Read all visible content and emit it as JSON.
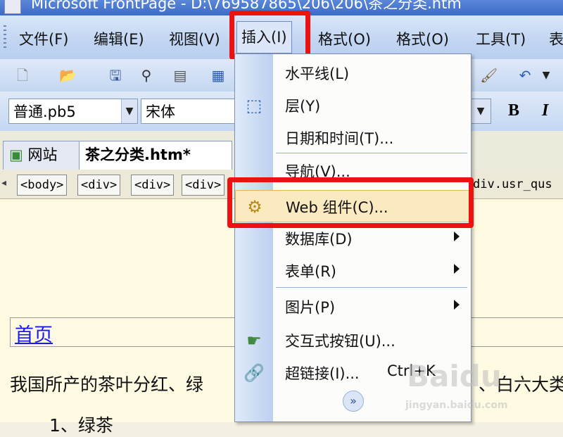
{
  "window": {
    "title": "Microsoft FrontPage - D:\\769587865\\206\\206\\茶之分类.htm"
  },
  "menubar": {
    "items": [
      "文件(F)",
      "编辑(E)",
      "视图(V)",
      "插入(I)",
      "格式(O)",
      "格式(O)",
      "工具(T)",
      "表"
    ],
    "active": "插入(I)"
  },
  "toolbar": {
    "style_combo": "普通.pb5",
    "font_combo": "宋体",
    "bold": "B",
    "italic": "I"
  },
  "tabs": [
    "网站",
    "茶之分类.htm*"
  ],
  "tagbar": [
    "<body>",
    "<div>",
    "<div>",
    "<div>",
    "div.usr_qus"
  ],
  "document": {
    "home_link": "首页",
    "paragraph": "我国所产的茶叶分红、绿",
    "paragraph_tail": "、白六大类",
    "list_item": "1、绿茶"
  },
  "insert_menu": {
    "items": [
      {
        "label": "水平线(L)",
        "icon": ""
      },
      {
        "label": "层(Y)",
        "icon": "layer-icon"
      },
      {
        "label": "日期和时间(T)...",
        "icon": ""
      },
      {
        "label": "导航(V)...",
        "icon": ""
      },
      {
        "label": "Web 组件(C)...",
        "icon": "web-component-icon",
        "highlighted": true
      },
      {
        "label": "数据库(D)",
        "submenu": true
      },
      {
        "label": "表单(R)",
        "submenu": true
      },
      {
        "label": "图片(P)",
        "submenu": true
      },
      {
        "label": "交互式按钮(U)...",
        "icon": "interactive-button-icon"
      },
      {
        "label": "超链接(I)...",
        "shortcut": "Ctrl+K",
        "icon": "hyperlink-icon"
      }
    ]
  },
  "watermark": {
    "text": "Baidu",
    "sub": "jingyan.baidu.com"
  },
  "colors": {
    "highlight_box": "#ee1111",
    "menu_highlight": "#fbe9c0",
    "link": "#1a1aee"
  }
}
